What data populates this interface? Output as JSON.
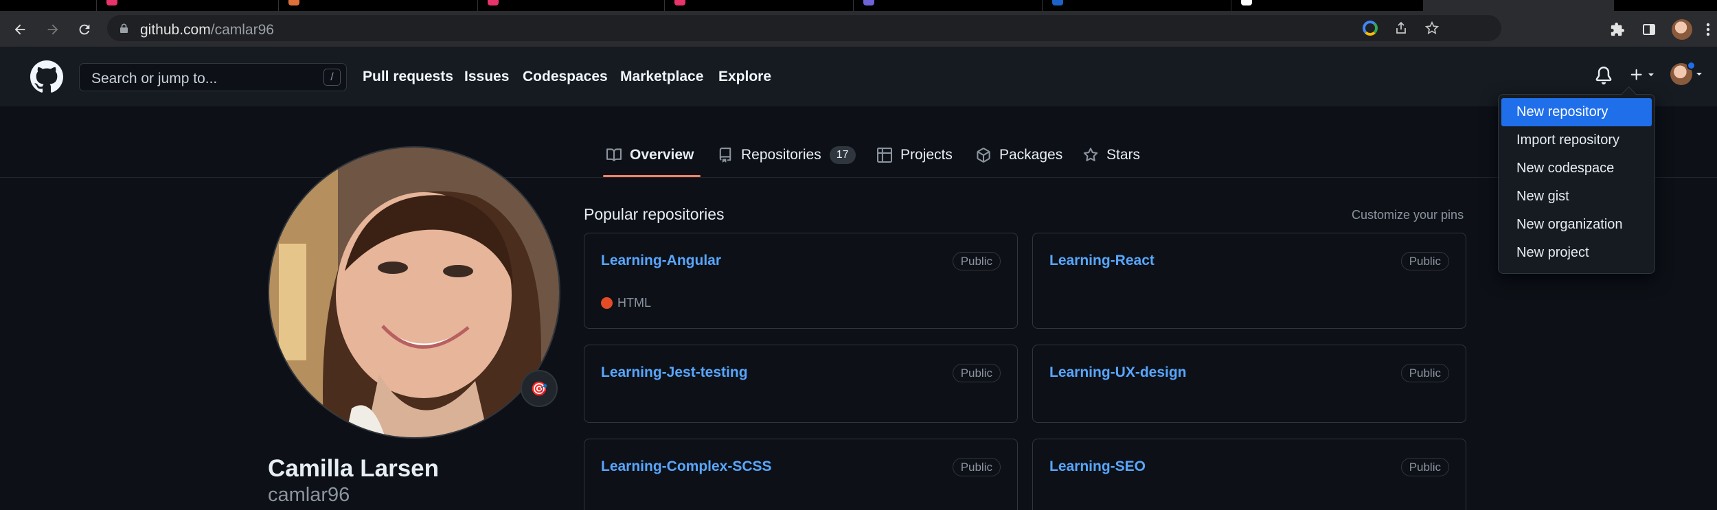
{
  "browser": {
    "url_host": "github.com",
    "url_path": "/camlar96",
    "tab_favicon_colors": [
      "#e8336b",
      "#e0703a",
      "#e8336b",
      "#e8336b",
      "#6e63d8",
      "#1d62c8",
      "#ffffff"
    ]
  },
  "header": {
    "search_placeholder": "Search or jump to...",
    "search_shortcut": "/",
    "nav": [
      "Pull requests",
      "Issues",
      "Codespaces",
      "Marketplace",
      "Explore"
    ]
  },
  "profile_tabs": {
    "overview": "Overview",
    "repositories": "Repositories",
    "repositories_count": "17",
    "projects": "Projects",
    "packages": "Packages",
    "stars": "Stars"
  },
  "profile": {
    "full_name": "Camilla Larsen",
    "login": "camlar96",
    "status_emoji": "🎯"
  },
  "pinned": {
    "title": "Popular repositories",
    "customize_link": "Customize your pins",
    "repos": [
      {
        "name": "Learning-Angular",
        "visibility": "Public",
        "language": "HTML",
        "language_color": "#e34c26"
      },
      {
        "name": "Learning-React",
        "visibility": "Public"
      },
      {
        "name": "Learning-Jest-testing",
        "visibility": "Public"
      },
      {
        "name": "Learning-UX-design",
        "visibility": "Public"
      },
      {
        "name": "Learning-Complex-SCSS",
        "visibility": "Public"
      },
      {
        "name": "Learning-SEO",
        "visibility": "Public"
      }
    ]
  },
  "create_menu": {
    "items": [
      "New repository",
      "Import repository",
      "New codespace",
      "New gist",
      "New organization",
      "New project"
    ]
  },
  "colors": {
    "accent_link": "#58a6ff",
    "selected_tab_underline": "#f78166",
    "menu_highlight": "#1f6feb",
    "notification_dot": "#1f6feb"
  }
}
